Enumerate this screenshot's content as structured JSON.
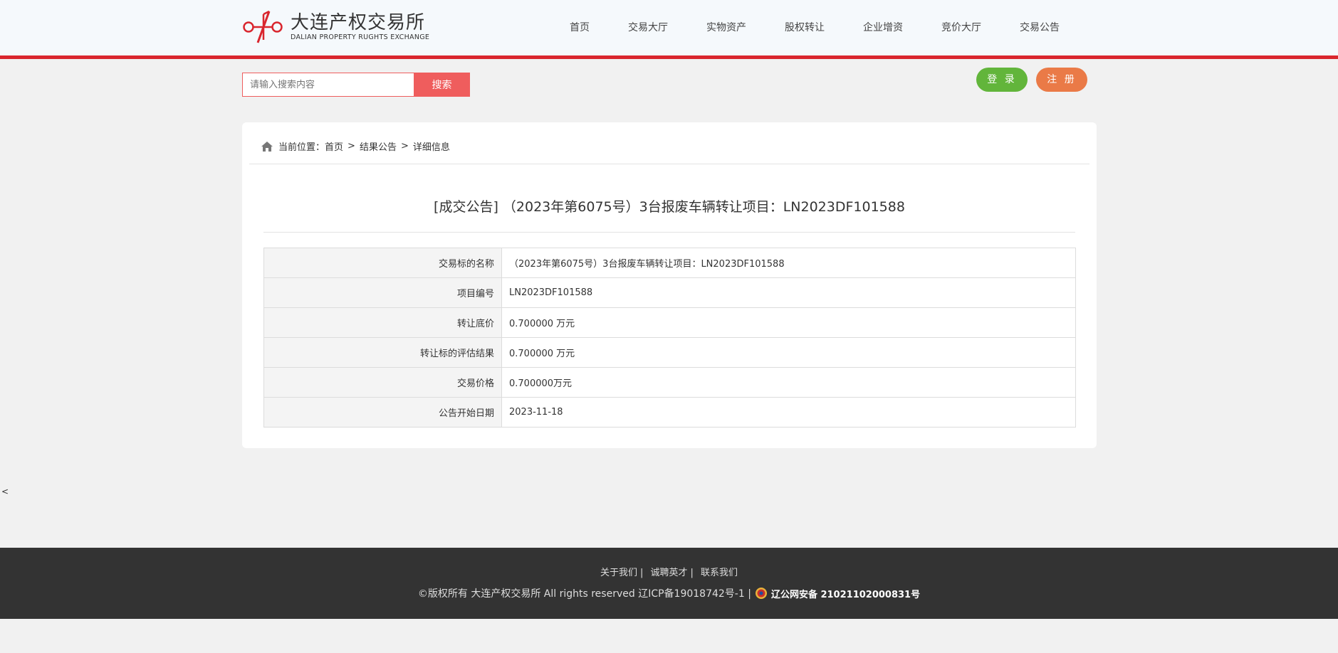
{
  "header": {
    "logo_cn": "大连产权交易所",
    "logo_en": "DALIAN PROPERTY RUGHTS EXCHANGE",
    "nav": [
      "首页",
      "交易大厅",
      "实物资产",
      "股权转让",
      "企业增资",
      "竞价大厅",
      "交易公告"
    ]
  },
  "search": {
    "placeholder": "请输入搜索内容",
    "button_label": "搜索"
  },
  "auth": {
    "login_label": "登 录",
    "register_label": "注 册"
  },
  "breadcrumb": {
    "prefix": "当前位置：",
    "items": [
      "首页",
      "结果公告",
      "详细信息"
    ],
    "separator": ">"
  },
  "article": {
    "title": "[成交公告] （2023年第6075号）3台报废车辆转让项目：LN2023DF101588",
    "rows": [
      {
        "label": "交易标的名称",
        "value": "（2023年第6075号）3台报废车辆转让项目：LN2023DF101588"
      },
      {
        "label": "项目编号",
        "value": "LN2023DF101588"
      },
      {
        "label": "转让底价",
        "value": "0.700000 万元"
      },
      {
        "label": "转让标的评估结果",
        "value": "0.700000 万元"
      },
      {
        "label": "交易价格",
        "value": "0.700000万元"
      },
      {
        "label": "公告开始日期",
        "value": "2023-11-18"
      }
    ]
  },
  "stray_text": "<",
  "footer": {
    "links": [
      "关于我们",
      "诚聘英才",
      "联系我们"
    ],
    "copyright": "©版权所有 大连产权交易所 All rights reserved 辽ICP备19018742号-1 |",
    "police": "辽公网安备 21021102000831号"
  },
  "colors": {
    "accent_red": "#d9262e",
    "search_red": "#ef5d5d",
    "login_green": "#62b53b",
    "register_orange": "#ea7a47",
    "footer_bg": "#333333"
  }
}
